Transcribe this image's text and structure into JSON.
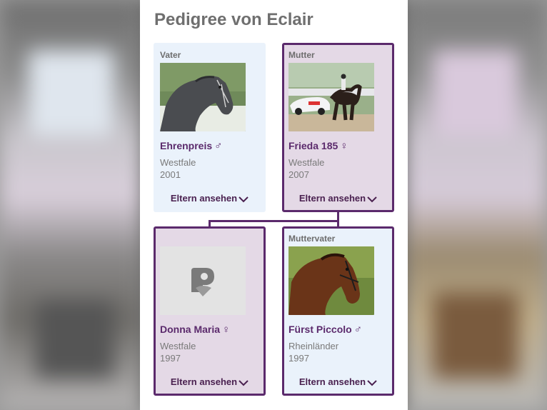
{
  "page": {
    "title": "Pedigree von Eclair"
  },
  "cards": [
    {
      "role": "Vater",
      "name": "Ehrenpreis",
      "sex_symbol": "♂",
      "breed": "Westfale",
      "year": "2001",
      "button": "Eltern ansehen",
      "photo": "horse-head-grey"
    },
    {
      "role": "Mutter",
      "name": "Frieda 185",
      "sex_symbol": "♀",
      "breed": "Westfale",
      "year": "2007",
      "button": "Eltern ansehen",
      "photo": "horse-dressage-arena"
    },
    {
      "role": "",
      "name": "Donna Maria",
      "sex_symbol": "♀",
      "breed": "Westfale",
      "year": "1997",
      "button": "Eltern ansehen",
      "photo": "placeholder-logo"
    },
    {
      "role": "Muttervater",
      "name": "Fürst Piccolo",
      "sex_symbol": "♂",
      "breed": "Rheinländer",
      "year": "1997",
      "button": "Eltern ansehen",
      "photo": "horse-head-brown"
    }
  ],
  "colors": {
    "accent": "#5b2a6c",
    "male_card": "#eaf2fb",
    "female_card": "#e4d9e6"
  }
}
